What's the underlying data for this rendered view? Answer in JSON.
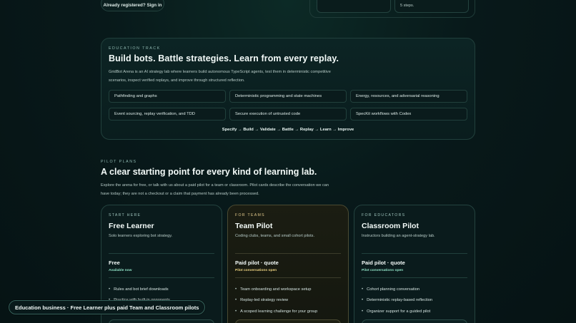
{
  "top": {
    "signin_label": "Already registered? Sign in",
    "steps_text": "5 steps."
  },
  "education": {
    "kicker": "EDUCATION TRACK",
    "title": "Build bots. Battle strategies. Learn from every replay.",
    "description": "GridBot Arena is an AI strategy lab where learners build autonomous TypeScript agents, test them in deterministic competitive scenarios, inspect verified replays, and improve through structured reflection.",
    "topics": [
      "Pathfinding and graphs",
      "Deterministic programming and state machines",
      "Energy, resources, and adversarial reasoning",
      "Event sourcing, replay verification, and TDD",
      "Secure execution of untrusted code",
      "SpecKit workflows with Codex"
    ],
    "flow": "Specify → Build → Validate → Battle → Replay → Learn → Improve"
  },
  "plans": {
    "kicker": "PILOT PLANS",
    "title": "A clear starting point for every kind of learning lab.",
    "description": "Explore the arena for free, or talk with us about a paid pilot for a team or classroom. Pilot cards describe the conversation we can have today; they are not a checkout or a claim that payment has already been processed.",
    "cards": [
      {
        "kicker": "START HERE",
        "name": "Free Learner",
        "subtitle": "Solo learners exploring bot strategy.",
        "price": "Free",
        "status": "Available now",
        "features": [
          "Rules and bot brief downloads",
          "Practice with built-in opponents"
        ]
      },
      {
        "kicker": "FOR TEAMS",
        "name": "Team Pilot",
        "subtitle": "Coding clubs, teams, and small cohort pilots.",
        "price": "Paid pilot · quote",
        "status": "Pilot conversations open",
        "features": [
          "Team onboarding and workspace setup",
          "Replay-led strategy review",
          "A scoped learning challenge for your group"
        ]
      },
      {
        "kicker": "FOR EDUCATORS",
        "name": "Classroom Pilot",
        "subtitle": "Instructors building an agent-strategy lab.",
        "price": "Paid pilot · quote",
        "status": "Pilot conversations open",
        "features": [
          "Cohort planning conversation",
          "Deterministic replay-based reflection",
          "Organizer support for a guided pilot"
        ]
      }
    ]
  },
  "toast": {
    "text": "Education business · Free Learner plus paid Team and Classroom pilots"
  }
}
